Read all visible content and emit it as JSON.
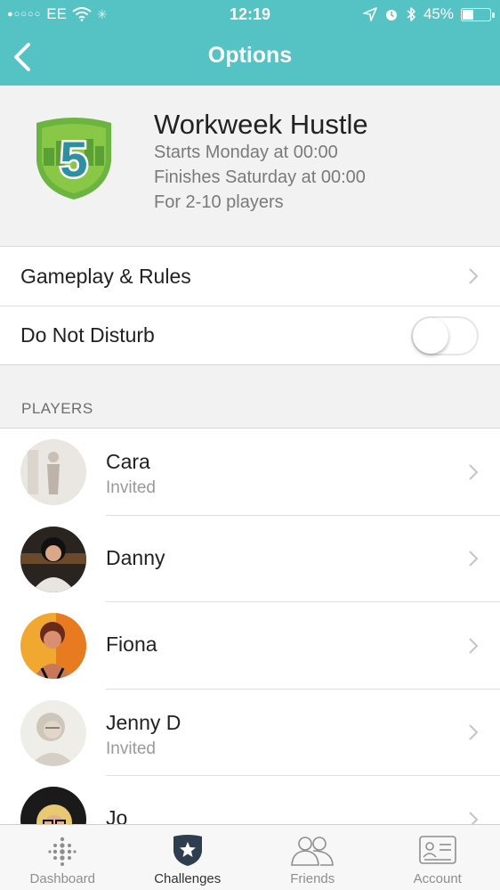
{
  "status_bar": {
    "carrier": "EE",
    "time": "12:19",
    "battery_percent": "45%",
    "battery_level": 0.45
  },
  "nav": {
    "title": "Options"
  },
  "challenge": {
    "badge_number": "5",
    "name": "Workweek Hustle",
    "starts": "Starts Monday at 00:00",
    "finishes": "Finishes Saturday at 00:00",
    "players_range": "For 2-10 players"
  },
  "settings": {
    "gameplay_label": "Gameplay & Rules",
    "dnd_label": "Do Not Disturb",
    "dnd_on": false
  },
  "players_section": {
    "label": "PLAYERS",
    "items": [
      {
        "name": "Cara",
        "status": "Invited"
      },
      {
        "name": "Danny",
        "status": ""
      },
      {
        "name": "Fiona",
        "status": ""
      },
      {
        "name": "Jenny D",
        "status": "Invited"
      },
      {
        "name": "Jo",
        "status": ""
      }
    ]
  },
  "tabs": [
    {
      "label": "Dashboard",
      "icon": "dots-grid-icon"
    },
    {
      "label": "Challenges",
      "icon": "star-shield-icon",
      "active": true
    },
    {
      "label": "Friends",
      "icon": "friends-icon"
    },
    {
      "label": "Account",
      "icon": "id-card-icon"
    }
  ],
  "colors": {
    "accent": "#55c2c4",
    "badge_green": "#7cc242"
  }
}
